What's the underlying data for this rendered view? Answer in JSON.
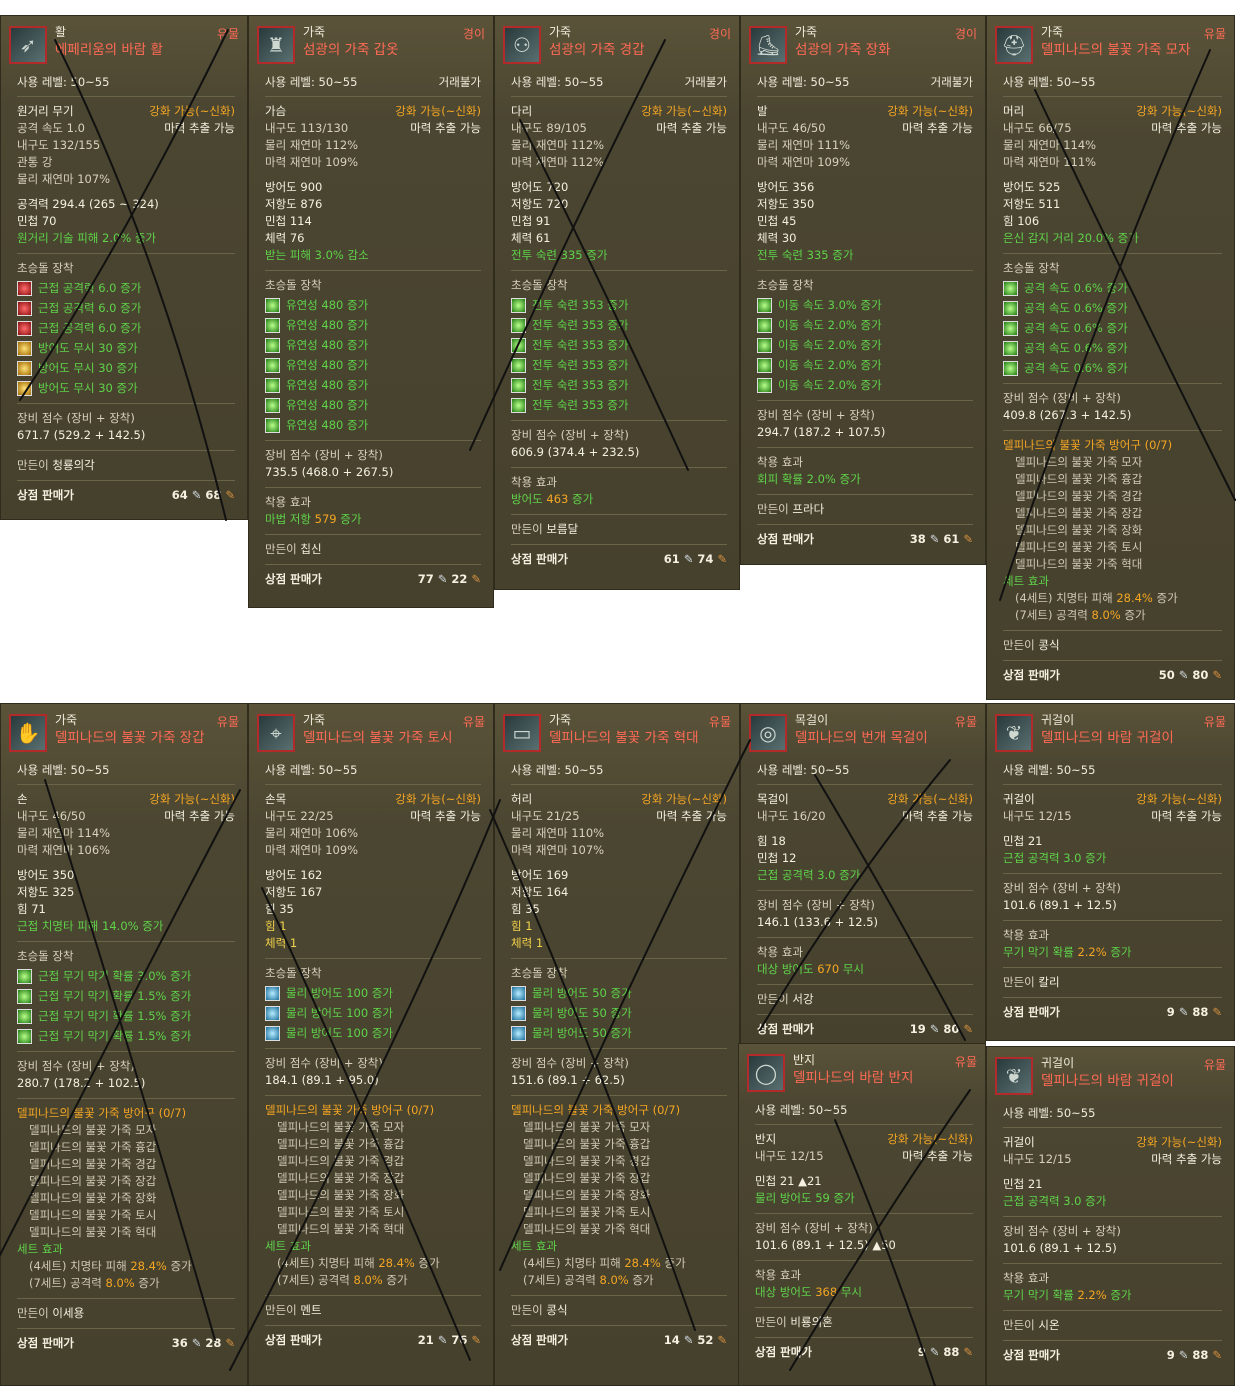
{
  "labels": {
    "use_level": "사용 레벨:",
    "gear_score": "장비 점수 (장비 + 장착)",
    "maker": "만든이",
    "shop": "상점 판매가",
    "soul_gem": "초승돌 장착",
    "wear_effect": "착용 효과",
    "set_effect": "세트 효과",
    "enhance": "강화 가능(~신화)",
    "extract": "마력 추출 가능",
    "no_trade": "거래불가"
  },
  "cards": [
    {
      "category": "활",
      "name": "에페리움의 바람 활",
      "grade": "유물",
      "level": "50~55",
      "icon": "bow-icon",
      "type": "원거리 무기",
      "stats": [
        "공격 속도 1.0",
        "내구도 132/155",
        "관통 강",
        "물리 재연마 107%"
      ],
      "stats2": [
        "공격력 294.4 (265 ~ 324)",
        "민첩 70"
      ],
      "bonus": "원거리 기술 피해 2.0% 증가",
      "gems": [
        {
          "c": "red",
          "t": "근접 공격력 6.0 증가"
        },
        {
          "c": "red",
          "t": "근접 공격력 6.0 증가"
        },
        {
          "c": "red",
          "t": "근접 공격력 6.0 증가"
        },
        {
          "c": "gold",
          "t": "방어도 무시 30 증가"
        },
        {
          "c": "gold",
          "t": "방어도 무시 30 증가"
        },
        {
          "c": "gold",
          "t": "방어도 무시 30 증가"
        }
      ],
      "score": "671.7 (529.2 + 142.5)",
      "maker": "청룡의각",
      "silver": "64",
      "bronze": "68"
    },
    {
      "category": "가죽",
      "name": "섬광의 가죽 갑옷",
      "grade": "경이",
      "level": "50~55",
      "icon": "leather-armor-icon",
      "notrade": true,
      "type": "가슴",
      "stats": [
        "내구도 113/130",
        "물리 재연마 112%",
        "마력 재연마 109%"
      ],
      "stats2": [
        "방어도 900",
        "저항도 876",
        "민첩 114",
        "체력 76"
      ],
      "bonus": "받는 피해 3.0% 감소",
      "gems": [
        {
          "c": "green",
          "t": "유연성 480 증가"
        },
        {
          "c": "green",
          "t": "유연성 480 증가"
        },
        {
          "c": "green",
          "t": "유연성 480 증가"
        },
        {
          "c": "green",
          "t": "유연성 480 증가"
        },
        {
          "c": "green",
          "t": "유연성 480 증가"
        },
        {
          "c": "green",
          "t": "유연성 480 증가"
        },
        {
          "c": "green",
          "t": "유연성 480 증가"
        }
      ],
      "score": "735.5 (468.0 + 267.5)",
      "wear": [
        "마법 저항 ",
        "579",
        " 증가"
      ],
      "maker": "칩신",
      "silver": "77",
      "bronze": "22"
    },
    {
      "category": "가죽",
      "name": "섬광의 가죽 경갑",
      "grade": "경이",
      "level": "50~55",
      "icon": "leather-pants-icon",
      "notrade": true,
      "type": "다리",
      "stats": [
        "내구도 89/105",
        "물리 재연마 112%",
        "마력 재연마 112%"
      ],
      "stats2": [
        "방어도 720",
        "저항도 720",
        "민첩 91",
        "체력 61"
      ],
      "bonus": "전투 숙련 335 증가",
      "gems": [
        {
          "c": "green",
          "t": "전투 숙련 353 증가"
        },
        {
          "c": "green",
          "t": "전투 숙련 353 증가"
        },
        {
          "c": "green",
          "t": "전투 숙련 353 증가"
        },
        {
          "c": "green",
          "t": "전투 숙련 353 증가"
        },
        {
          "c": "green",
          "t": "전투 숙련 353 증가"
        },
        {
          "c": "green",
          "t": "전투 숙련 353 증가"
        }
      ],
      "score": "606.9 (374.4 + 232.5)",
      "wear": [
        "방어도 ",
        "463",
        " 증가"
      ],
      "maker": "보름달",
      "silver": "61",
      "bronze": "74"
    },
    {
      "category": "가죽",
      "name": "섬광의 가죽 장화",
      "grade": "경이",
      "level": "50~55",
      "icon": "leather-boots-icon",
      "notrade": true,
      "type": "발",
      "stats": [
        "내구도 46/50",
        "물리 재연마 111%",
        "마력 재연마 109%"
      ],
      "stats2": [
        "방어도 356",
        "저항도 350",
        "민첩 45",
        "체력 30"
      ],
      "bonus": "전투 숙련 335 증가",
      "gems": [
        {
          "c": "green",
          "t": "이동 속도 3.0% 증가"
        },
        {
          "c": "green",
          "t": "이동 속도 2.0% 증가"
        },
        {
          "c": "green",
          "t": "이동 속도 2.0% 증가"
        },
        {
          "c": "green",
          "t": "이동 속도 2.0% 증가"
        },
        {
          "c": "green",
          "t": "이동 속도 2.0% 증가"
        }
      ],
      "score": "294.7 (187.2 + 107.5)",
      "wear": [
        "회피 확률 2.0% 증가",
        "",
        ""
      ],
      "maker": "프라다",
      "silver": "38",
      "bronze": "61"
    },
    {
      "category": "가죽",
      "name": "델피나드의 불꽃 가죽 모자",
      "grade": "유물",
      "level": "50~55",
      "icon": "leather-hat-icon",
      "type": "머리",
      "stats": [
        "내구도 66/75",
        "물리 재연마 114%",
        "마력 재연마 111%"
      ],
      "stats2": [
        "방어도 525",
        "저항도 511",
        "힘 106"
      ],
      "bonus": "은신 감지 거리 20.0% 증가",
      "gems": [
        {
          "c": "green",
          "t": "공격 속도 0.6% 증가"
        },
        {
          "c": "green",
          "t": "공격 속도 0.6% 증가"
        },
        {
          "c": "green",
          "t": "공격 속도 0.6% 증가"
        },
        {
          "c": "green",
          "t": "공격 속도 0.6% 증가"
        },
        {
          "c": "green",
          "t": "공격 속도 0.6% 증가"
        }
      ],
      "score": "409.8 (267.3 + 142.5)",
      "set": true,
      "maker": "콩식",
      "silver": "50",
      "bronze": "80"
    },
    {
      "category": "가죽",
      "name": "델피나드의 불꽃 가죽 장갑",
      "grade": "유물",
      "level": "50~55",
      "icon": "leather-gloves-icon",
      "type": "손",
      "stats": [
        "내구도 46/50",
        "물리 재연마 114%",
        "마력 재연마 106%"
      ],
      "stats2": [
        "방어도 350",
        "저항도 325",
        "힘 71"
      ],
      "bonus": "근접 치명타 피해 14.0% 증가",
      "gems": [
        {
          "c": "green",
          "t": "근접 무기 막기 확률 3.0% 증가"
        },
        {
          "c": "green",
          "t": "근접 무기 막기 확률 1.5% 증가"
        },
        {
          "c": "green",
          "t": "근접 무기 막기 확률 1.5% 증가"
        },
        {
          "c": "green",
          "t": "근접 무기 막기 확률 1.5% 증가"
        }
      ],
      "score": "280.7 (178.2 + 102.5)",
      "set": true,
      "maker": "이세용",
      "silver": "36",
      "bronze": "28"
    },
    {
      "category": "가죽",
      "name": "델피나드의 불꽃 가죽 토시",
      "grade": "유물",
      "level": "50~55",
      "icon": "leather-bracer-icon",
      "type": "손목",
      "stats": [
        "내구도 22/25",
        "물리 재연마 106%",
        "마력 재연마 109%"
      ],
      "stats2": [
        "방어도 162",
        "저항도 167",
        "힘 35"
      ],
      "extra": [
        "힘 1",
        "체력 1"
      ],
      "bonus": "",
      "gems": [
        {
          "c": "blue",
          "t": "물리 방어도 100 증가"
        },
        {
          "c": "blue",
          "t": "물리 방어도 100 증가"
        },
        {
          "c": "blue",
          "t": "물리 방어도 100 증가"
        }
      ],
      "score": "184.1 (89.1 + 95.0)",
      "set": true,
      "maker": "멘트",
      "silver": "21",
      "bronze": "76"
    },
    {
      "category": "가죽",
      "name": "델피나드의 불꽃 가죽 혁대",
      "grade": "유물",
      "level": "50~55",
      "icon": "leather-belt-icon",
      "type": "허리",
      "stats": [
        "내구도 21/25",
        "물리 재연마 110%",
        "마력 재연마 107%"
      ],
      "stats2": [
        "방어도 169",
        "저항도 164",
        "힘 35"
      ],
      "extra": [
        "힘 1",
        "체력 1"
      ],
      "bonus": "",
      "gems": [
        {
          "c": "blue",
          "t": "물리 방어도 50 증가"
        },
        {
          "c": "blue",
          "t": "물리 방어도 50 증가"
        },
        {
          "c": "blue",
          "t": "물리 방어도 50 증가"
        }
      ],
      "score": "151.6 (89.1 + 62.5)",
      "set": true,
      "maker": "콩식",
      "silver": "14",
      "bronze": "52"
    },
    {
      "category": "목걸이",
      "name": "델피나드의 번개 목걸이",
      "grade": "유물",
      "level": "50~55",
      "icon": "necklace-icon",
      "type": "목걸이",
      "stats": [
        "내구도 16/20"
      ],
      "stats2": [
        "힘 18",
        "민첩 12"
      ],
      "bonus": "근접 공격력 3.0 증가",
      "gems": [],
      "score": "146.1 (133.6 + 12.5)",
      "wear": [
        "대상 방어도 ",
        "670",
        " 무시"
      ],
      "maker": "서강",
      "silver": "19",
      "bronze": "80"
    },
    {
      "category": "귀걸이",
      "name": "델피나드의 바람 귀걸이",
      "grade": "유물",
      "level": "50~55",
      "icon": "earring-icon",
      "type": "귀걸이",
      "stats": [
        "내구도 12/15"
      ],
      "stats2": [
        "민첩 21"
      ],
      "bonus": "근접 공격력 3.0 증가",
      "gems": [],
      "score": "101.6 (89.1 + 12.5)",
      "wear": [
        "무기 막기 확률 ",
        "2.2%",
        " 증가"
      ],
      "maker": "칼리",
      "silver": "9",
      "bronze": "88"
    },
    {
      "category": "반지",
      "name": "델피나드의 바람 반지",
      "grade": "유물",
      "level": "50~55",
      "icon": "ring-icon",
      "type": "반지",
      "stats": [
        "내구도 12/15"
      ],
      "stats2": [
        "민첩 21 ▲21"
      ],
      "bonus": "물리 방어도 59 증가",
      "gems": [],
      "score": "101.6 (89.1 + 12.5) ▲50",
      "wear": [
        "대상 방어도 ",
        "368",
        " 무시"
      ],
      "maker": "비룡의혼",
      "silver": "9",
      "bronze": "88"
    },
    {
      "category": "귀걸이",
      "name": "델피나드의 바람 귀걸이",
      "grade": "유물",
      "level": "50~55",
      "icon": "earring-icon",
      "type": "귀걸이",
      "stats": [
        "내구도 12/15"
      ],
      "stats2": [
        "민첩 21"
      ],
      "bonus": "근접 공격력 3.0 증가",
      "gems": [],
      "score": "101.6 (89.1 + 12.5)",
      "wear": [
        "무기 막기 확률 ",
        "2.2%",
        " 증가"
      ],
      "maker": "시온",
      "silver": "9",
      "bronze": "88"
    }
  ],
  "set": {
    "title": "델피나드의 불꽃 가죽 방어구 (0/7)",
    "items": [
      "델피나드의 불꽃 가죽 모자",
      "델피나드의 불꽃 가죽 흉갑",
      "델피나드의 불꽃 가죽 경갑",
      "델피나드의 불꽃 가죽 장갑",
      "델피나드의 불꽃 가죽 장화",
      "델피나드의 불꽃 가죽 토시",
      "델피나드의 불꽃 가죽 혁대"
    ],
    "eff4": [
      "(4세트) 치명타 피해 ",
      "28.4%",
      " 증가"
    ],
    "eff7": [
      "(7세트) 공격력 ",
      "8.0%",
      " 증가"
    ]
  }
}
